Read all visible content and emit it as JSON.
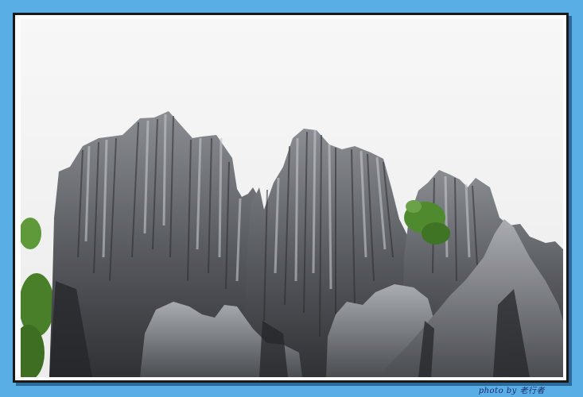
{
  "photo": {
    "subject": "stone-forest-karst-pinnacles",
    "colors": {
      "page_background": "#5aaee6",
      "sky": "#f7f7f7",
      "rock_dark": "#3f4246",
      "rock_mid": "#6f7378",
      "rock_light": "#b4b7bb",
      "foliage": "#4f8b2e"
    }
  },
  "caption": {
    "text": "photo by 老行者"
  }
}
